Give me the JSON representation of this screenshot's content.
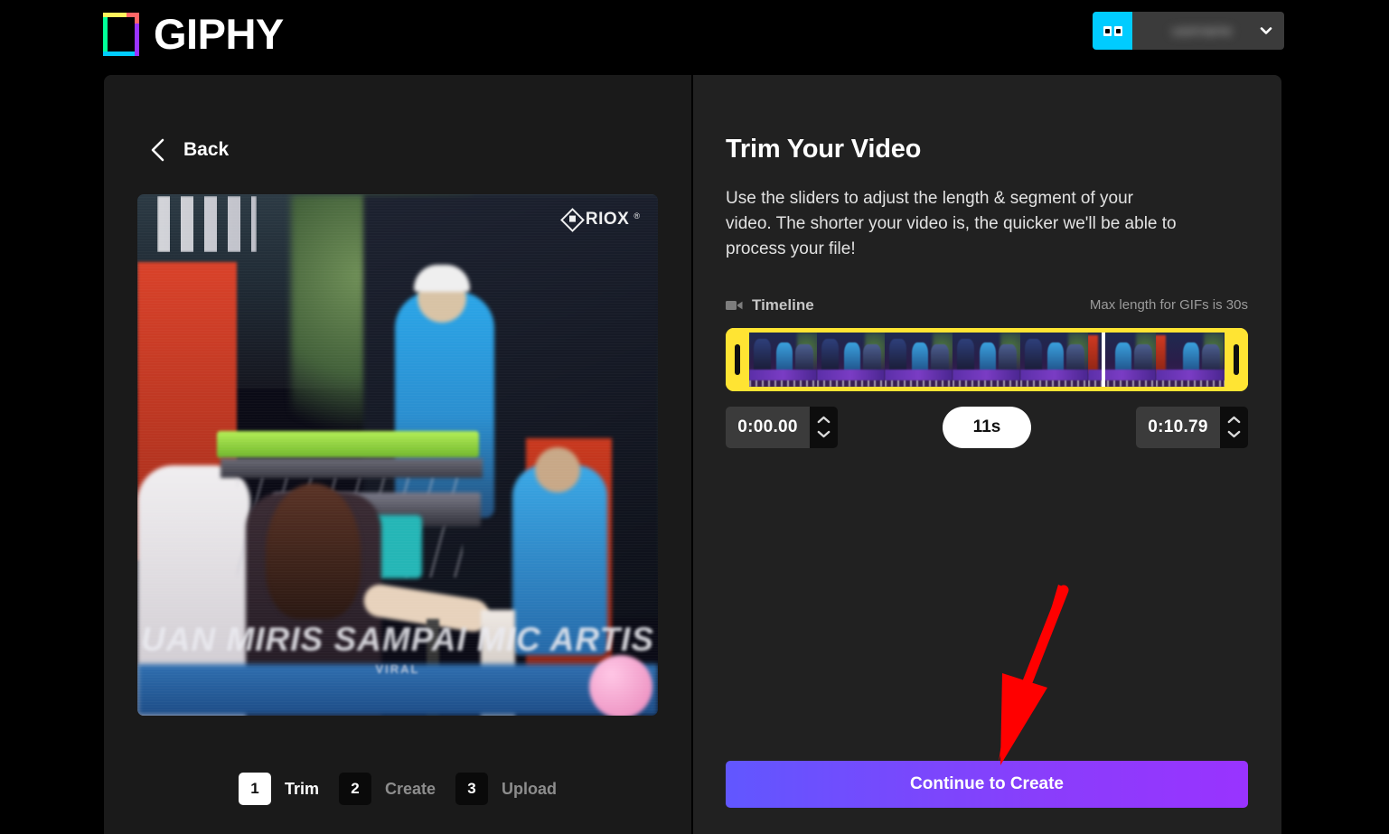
{
  "header": {
    "brand_name": "GIPHY",
    "logo_icon": "giphy-logo-icon",
    "avatar_icon": "googly-eyes-avatar-icon",
    "user_name": "username",
    "chevron_icon": "chevron-down-icon"
  },
  "left_panel": {
    "back": {
      "label": "Back",
      "icon": "chevron-left-icon"
    },
    "video": {
      "watermark_text": "RIOX",
      "watermark_registered": "®",
      "watermark_icon": "riox-diamond-icon",
      "caption": "UAN MIRIS SAMPAI MIC ARTIS",
      "caption_sub": "VIRAL"
    },
    "steps": [
      {
        "number": "1",
        "label": "Trim",
        "state": "active"
      },
      {
        "number": "2",
        "label": "Create",
        "state": "idle"
      },
      {
        "number": "3",
        "label": "Upload",
        "state": "idle"
      }
    ]
  },
  "right_panel": {
    "title": "Trim Your Video",
    "description": "Use the sliders to adjust the length & segment of your video. The shorter your video is, the quicker we'll be able to process your file!",
    "timeline": {
      "label": "Timeline",
      "icon": "video-camera-icon",
      "max_length_note": "Max length for GIFs is 30s",
      "playhead_percent": 72,
      "handle_left_icon": "trim-handle-left-icon",
      "handle_right_icon": "trim-handle-right-icon"
    },
    "controls": {
      "start_time": "0:00.00",
      "end_time": "0:10.79",
      "duration": "11s",
      "stepper_up_icon": "chevron-up-icon",
      "stepper_down_icon": "chevron-down-icon"
    },
    "cta_label": "Continue to Create"
  },
  "annotation": {
    "arrow_icon": "red-arrow-icon",
    "arrow_color": "#FF0000"
  },
  "colors": {
    "page_background": "#000000",
    "panel_left": "#1A1A1A",
    "panel_right": "#212121",
    "timeline_accent": "#FFE433",
    "avatar_accent": "#00CCFF",
    "cta_gradient_start": "#6157FF",
    "cta_gradient_end": "#9933FF"
  }
}
